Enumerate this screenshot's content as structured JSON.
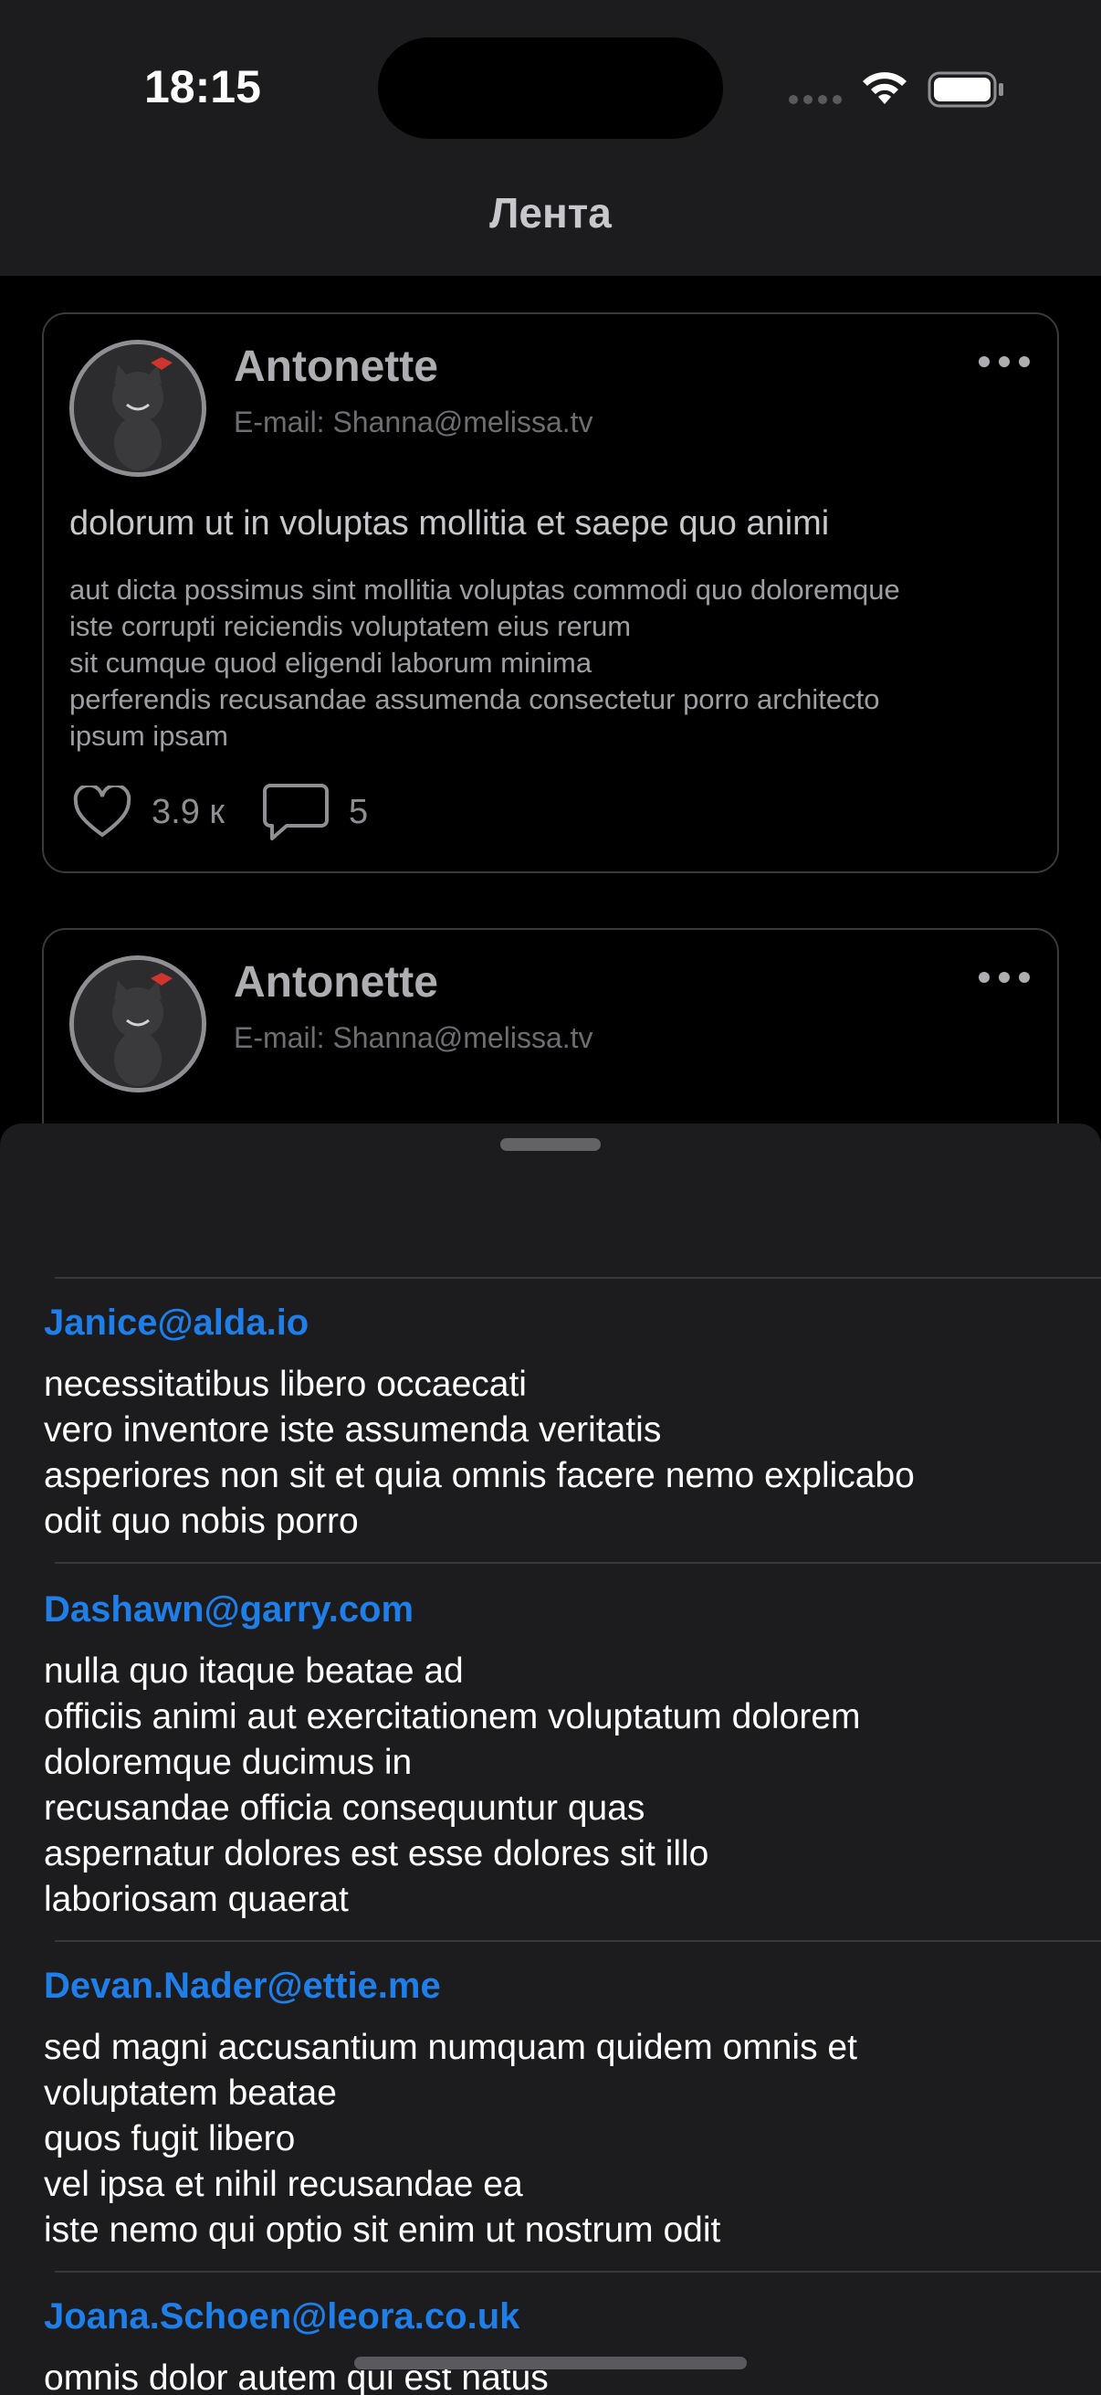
{
  "status_bar": {
    "time": "18:15"
  },
  "nav": {
    "title": "Лента"
  },
  "posts": [
    {
      "author": "Antonette",
      "email": "E-mail: Shanna@melissa.tv",
      "title": "dolorum ut in voluptas mollitia et saepe quo animi",
      "body": "aut dicta possimus sint mollitia voluptas commodi quo doloremque\niste corrupti reiciendis voluptatem eius rerum\nsit cumque quod eligendi laborum minima\nperferendis recusandae assumenda consectetur porro architecto\nipsum ipsam",
      "likes": "3.9 к",
      "comments": "5"
    },
    {
      "author": "Antonette",
      "email": "E-mail: Shanna@melissa.tv"
    }
  ],
  "comments_sheet": {
    "comments": [
      {
        "email": "Janice@alda.io",
        "body": "necessitatibus libero occaecati\nvero inventore iste assumenda veritatis\nasperiores non sit et quia omnis facere nemo explicabo\nodit quo nobis porro"
      },
      {
        "email": "Dashawn@garry.com",
        "body": "nulla quo itaque beatae ad\nofficiis animi aut exercitationem voluptatum dolorem\ndoloremque ducimus in\nrecusandae officia consequuntur quas\naspernatur dolores est esse dolores sit illo\nlaboriosam quaerat"
      },
      {
        "email": "Devan.Nader@ettie.me",
        "body": "sed magni accusantium numquam quidem omnis et\nvoluptatem beatae\nquos fugit libero\nvel ipsa et nihil recusandae ea\niste nemo qui optio sit enim ut nostrum odit"
      },
      {
        "email": "Joana.Schoen@leora.co.uk",
        "body": "omnis dolor autem qui est natus"
      }
    ]
  },
  "colors": {
    "accent": "#1f7ee8",
    "sheet_bg": "#1c1c1e",
    "card_border": "#3a3a3c"
  }
}
